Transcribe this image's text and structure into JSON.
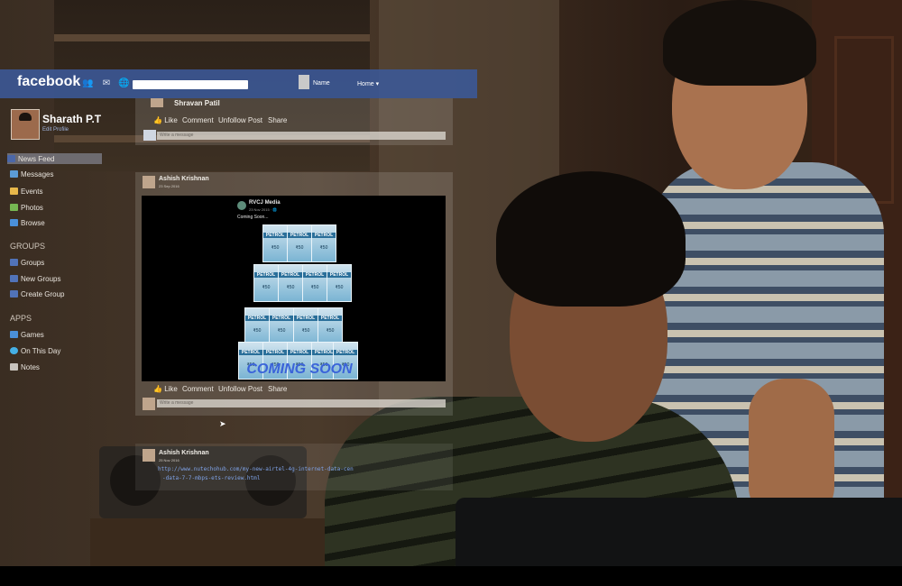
{
  "topbar": {
    "logo": "facebook",
    "search_placeholder": "",
    "user_name": "Name",
    "home_label": "Home ▾"
  },
  "profile": {
    "name": "Sharath P.T",
    "edit_label": "Edit Profile"
  },
  "sidebar": {
    "favorites": [
      {
        "label": "News Feed",
        "icon": "news-feed-icon",
        "color": "#4b67a8"
      },
      {
        "label": "Messages",
        "icon": "messages-icon",
        "color": "#5b9bd5"
      },
      {
        "label": "Events",
        "icon": "events-icon",
        "color": "#e8b84a"
      },
      {
        "label": "Photos",
        "icon": "photos-icon",
        "color": "#76b852"
      },
      {
        "label": "Browse",
        "icon": "browse-icon",
        "color": "#4a90d9"
      }
    ],
    "groups_heading": "GROUPS",
    "groups": [
      {
        "label": "Groups",
        "icon": "groups-icon",
        "color": "#5173b8"
      },
      {
        "label": "New Groups",
        "icon": "new-groups-icon",
        "color": "#5173b8"
      },
      {
        "label": "Create Group",
        "icon": "create-group-icon",
        "color": "#5173b8"
      }
    ],
    "apps_heading": "APPS",
    "apps": [
      {
        "label": "Games",
        "icon": "games-icon",
        "color": "#4a90d9"
      },
      {
        "label": "On This Day",
        "icon": "on-this-day-icon",
        "color": "#45b0e5"
      },
      {
        "label": "Notes",
        "icon": "notes-icon",
        "color": "#c9c4bd"
      }
    ]
  },
  "feed": {
    "post1": {
      "author": "Shravan Patil",
      "actions": [
        "Like",
        "Comment",
        "Unfollow Post",
        "Share"
      ],
      "comment_placeholder": "Write a message"
    },
    "post2": {
      "author": "Ashish Krishnan",
      "date": "23 Sep 2016",
      "shared_page": "RVCJ Media",
      "shared_date": "23 Nov 2015 · 🌐",
      "caption": "Coming Soon...",
      "sachet_label": "PETROL",
      "sachet_price": "₹50",
      "overlay_text": "COMING SOON",
      "actions": [
        "Like",
        "Comment",
        "Unfollow Post",
        "Share"
      ],
      "comment_placeholder": "Write a message"
    },
    "post3": {
      "author": "Ashish Krishnan",
      "date": "25 Nov 2016",
      "link_line1": "http://www.nutechohub.com/my-new-airtel-4g-internet-data-cen",
      "link_line2": "-data-7-7-mbps-ets-review.html"
    }
  }
}
